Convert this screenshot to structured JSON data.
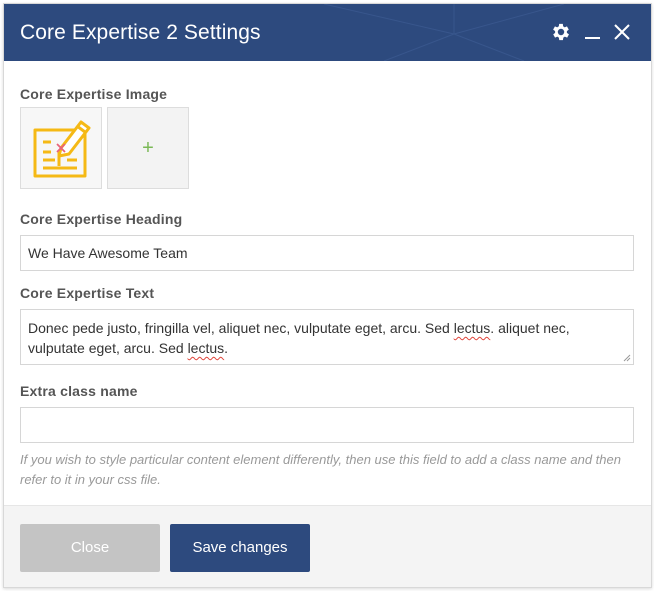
{
  "dialog": {
    "title": "Core Expertise 2 Settings",
    "icons": [
      "gear-icon",
      "minimize-icon",
      "close-icon"
    ],
    "header_color": "#2d4a7e"
  },
  "fields": {
    "image_label": "Core Expertise Image",
    "image_icon": "blueprint-pencil-icon",
    "add_image": "+",
    "heading_label": "Core Expertise Heading",
    "heading_value": "We Have Awesome Team",
    "text_label": "Core Expertise Text",
    "text_line1_a": "Donec pede justo, fringilla vel, aliquet nec, vulputate eget, arcu. Sed ",
    "text_line1_b": "lectus",
    "text_line1_c": ". aliquet nec,",
    "text_line2_a": "vulputate eget, arcu. Sed ",
    "text_line2_b": "lectus",
    "text_line2_c": ".",
    "extra_label": "Extra class name",
    "extra_value": "",
    "hint": "If you wish to style particular content element differently, then use this field to add a class name and then refer to it in your css file."
  },
  "footer": {
    "close_label": "Close",
    "save_label": "Save changes"
  },
  "colors": {
    "accent": "#2d4a7e",
    "icon_yellow": "#f5b915",
    "add_green": "#7ab855",
    "close_button": "#c4c4c4"
  }
}
